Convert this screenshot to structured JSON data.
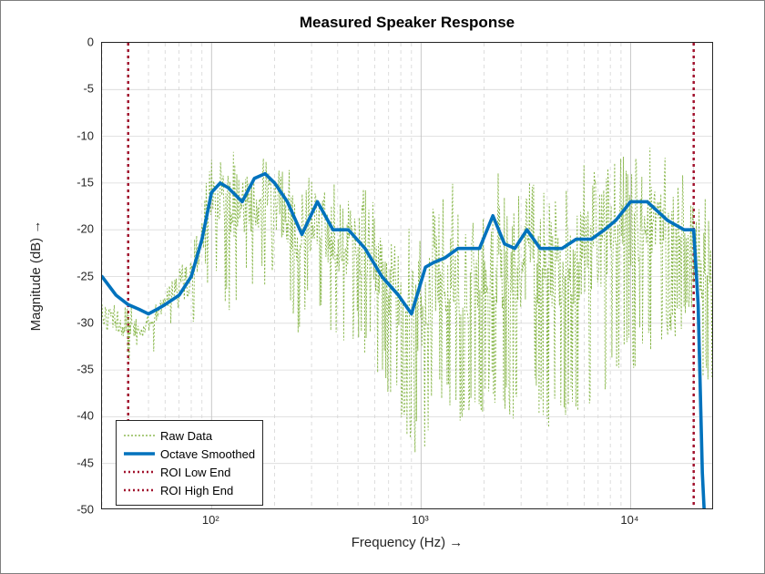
{
  "chart_data": {
    "type": "line",
    "title": "Measured Speaker Response",
    "xlabel": "Frequency  (Hz)   →",
    "ylabel": "Magnitude  (dB)   →",
    "xscale": "log",
    "xlim": [
      30,
      25000
    ],
    "ylim": [
      -50,
      0
    ],
    "xticks_major": [
      100,
      1000,
      10000
    ],
    "xtick_labels": [
      "10²",
      "10³",
      "10⁴"
    ],
    "yticks": [
      0,
      -5,
      -10,
      -15,
      -20,
      -25,
      -30,
      -35,
      -40,
      -45,
      -50
    ],
    "legend": {
      "position": "lower-left",
      "entries": [
        "Raw Data",
        "Octave Smoothed",
        "ROI Low End",
        "ROI High End"
      ]
    },
    "roi": {
      "low_hz": 40,
      "high_hz": 20000
    },
    "colors": {
      "raw": "#77AC30",
      "smoothed": "#0072BD",
      "roi": "#A2142F",
      "grid": "#B0B0B0"
    },
    "series": [
      {
        "name": "Octave Smoothed",
        "x": [
          30,
          35,
          40,
          45,
          50,
          55,
          60,
          70,
          80,
          90,
          100,
          110,
          120,
          140,
          160,
          180,
          200,
          230,
          270,
          320,
          380,
          450,
          540,
          650,
          780,
          900,
          1050,
          1150,
          1300,
          1500,
          1700,
          1900,
          2200,
          2500,
          2800,
          3200,
          3700,
          4200,
          4700,
          5500,
          6500,
          7500,
          8500,
          10000,
          12000,
          15000,
          18000,
          20000,
          21000,
          22000,
          23000
        ],
        "y": [
          -25,
          -27,
          -28,
          -28.5,
          -29,
          -28.5,
          -28,
          -27,
          -25,
          -21,
          -16,
          -15,
          -15.5,
          -17,
          -14.5,
          -14,
          -15,
          -17,
          -20.5,
          -17,
          -20,
          -20,
          -22,
          -25,
          -27,
          -29,
          -24,
          -23.5,
          -23,
          -22,
          -22,
          -22,
          -18.5,
          -21.5,
          -22,
          -20,
          -22,
          -22,
          -22,
          -21,
          -21,
          -20,
          -19,
          -17,
          -17,
          -19,
          -20,
          -20,
          -28,
          -46,
          -55
        ]
      },
      {
        "name": "Raw Data",
        "note": "noisy measurement; min/max envelope approximated per band",
        "envelope": [
          {
            "x": 30,
            "lo": -33,
            "hi": -27
          },
          {
            "x": 40,
            "lo": -34,
            "hi": -28
          },
          {
            "x": 50,
            "lo": -33,
            "hi": -29
          },
          {
            "x": 60,
            "lo": -30,
            "hi": -26
          },
          {
            "x": 80,
            "lo": -31,
            "hi": -22
          },
          {
            "x": 100,
            "lo": -23,
            "hi": -12
          },
          {
            "x": 120,
            "lo": -28,
            "hi": -11
          },
          {
            "x": 150,
            "lo": -26,
            "hi": -12
          },
          {
            "x": 200,
            "lo": -26,
            "hi": -11
          },
          {
            "x": 260,
            "lo": -30,
            "hi": -14
          },
          {
            "x": 320,
            "lo": -27,
            "hi": -14
          },
          {
            "x": 400,
            "lo": -32,
            "hi": -15
          },
          {
            "x": 500,
            "lo": -31,
            "hi": -15
          },
          {
            "x": 650,
            "lo": -35,
            "hi": -17
          },
          {
            "x": 800,
            "lo": -40,
            "hi": -19
          },
          {
            "x": 1000,
            "lo": -44,
            "hi": -18
          },
          {
            "x": 1200,
            "lo": -38,
            "hi": -15
          },
          {
            "x": 1500,
            "lo": -40,
            "hi": -15
          },
          {
            "x": 1800,
            "lo": -40,
            "hi": -15
          },
          {
            "x": 2200,
            "lo": -37,
            "hi": -13
          },
          {
            "x": 2700,
            "lo": -40,
            "hi": -14
          },
          {
            "x": 3300,
            "lo": -37,
            "hi": -13
          },
          {
            "x": 4000,
            "lo": -40,
            "hi": -13
          },
          {
            "x": 5000,
            "lo": -40,
            "hi": -12
          },
          {
            "x": 6000,
            "lo": -38,
            "hi": -11
          },
          {
            "x": 7500,
            "lo": -37,
            "hi": -10
          },
          {
            "x": 9000,
            "lo": -35,
            "hi": -9
          },
          {
            "x": 11000,
            "lo": -33,
            "hi": -9
          },
          {
            "x": 14000,
            "lo": -31,
            "hi": -10
          },
          {
            "x": 18000,
            "lo": -30,
            "hi": -12
          },
          {
            "x": 20000,
            "lo": -28,
            "hi": -14
          },
          {
            "x": 22000,
            "lo": -36,
            "hi": -16
          }
        ]
      }
    ]
  },
  "ui": {}
}
